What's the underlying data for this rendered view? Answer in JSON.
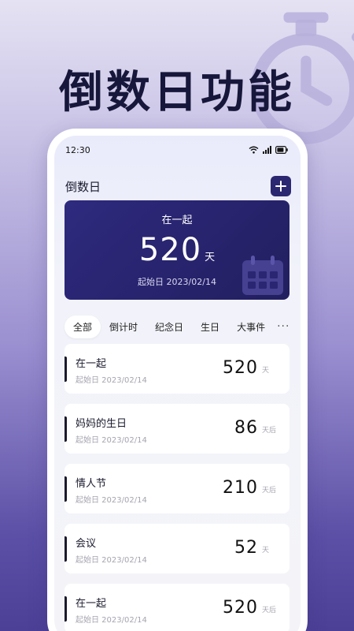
{
  "promo": {
    "title": "倒数日功能"
  },
  "status_bar": {
    "time": "12:30"
  },
  "header": {
    "title": "倒数日",
    "add_icon": "plus-icon"
  },
  "hero": {
    "title": "在一起",
    "days": "520",
    "unit": "天",
    "start_label": "起始日 2023/02/14",
    "icon": "calendar-icon"
  },
  "tabs": [
    {
      "label": "全部",
      "active": true
    },
    {
      "label": "倒计时",
      "active": false
    },
    {
      "label": "纪念日",
      "active": false
    },
    {
      "label": "生日",
      "active": false
    },
    {
      "label": "大事件",
      "active": false
    }
  ],
  "tabs_more": "···",
  "items": [
    {
      "name": "在一起",
      "date": "起始日 2023/02/14",
      "days": "520",
      "unit": "天"
    },
    {
      "name": "妈妈的生日",
      "date": "起始日 2023/02/14",
      "days": "86",
      "unit": "天后"
    },
    {
      "name": "情人节",
      "date": "起始日 2023/02/14",
      "days": "210",
      "unit": "天后"
    },
    {
      "name": "会议",
      "date": "起始日 2023/02/14",
      "days": "52",
      "unit": "天"
    },
    {
      "name": "在一起",
      "date": "起始日 2023/02/14",
      "days": "520",
      "unit": "天后"
    }
  ],
  "colors": {
    "accent": "#2b2770",
    "hero_bg": "#2e2a7e",
    "text": "#1a1a2e",
    "muted": "#a5a5b0"
  }
}
